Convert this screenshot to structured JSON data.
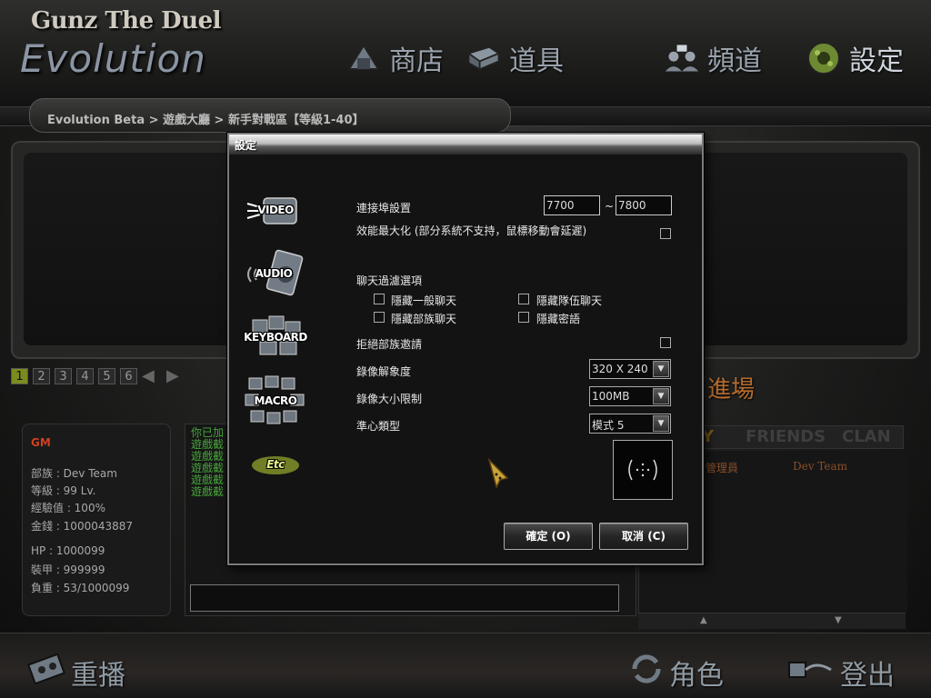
{
  "header": {
    "logo_small": "Gunz The Duel",
    "logo_big": "Evolution",
    "nav": [
      {
        "label": "商店",
        "icon": "shop-icon"
      },
      {
        "label": "道具",
        "icon": "equipment-icon"
      },
      {
        "label": "頻道",
        "icon": "channel-icon"
      },
      {
        "label": "設定",
        "icon": "settings-icon"
      }
    ],
    "breadcrumb": "Evolution Beta > 遊戲大廳 > 新手對戰區【等級1-40】"
  },
  "lobby": {
    "pages": [
      "1",
      "2",
      "3",
      "4",
      "5",
      "6"
    ],
    "enter_label": "進場",
    "player": {
      "name": "GM",
      "clan": "部族 : Dev Team",
      "level": "等級 : 99 Lv.",
      "exp": "經驗值 : 100%",
      "money": "金錢 : 1000043887",
      "hp": "HP : 1000099",
      "ap": "裝甲 : 999999",
      "weight": "負重 : 53/1000099"
    },
    "chat_lines": [
      "你已加",
      "遊戲截",
      "遊戲截",
      "遊戲截",
      "遊戲截",
      "遊戲截"
    ],
    "tabs": [
      "Y",
      "FRIENDS",
      "CLAN"
    ],
    "member": {
      "grade": "管理員",
      "clan": "Dev Team"
    }
  },
  "footer": {
    "replay": "重播",
    "character": "角色",
    "logout": "登出"
  },
  "dialog": {
    "title": "設定",
    "categories": [
      "VIDEO",
      "AUDIO",
      "KEYBOARD",
      "MACRO",
      "Etc"
    ],
    "port_label": "連接埠設置",
    "port_from": "7700",
    "port_sep": "~",
    "port_to": "7800",
    "maximize_perf_label": "效能最大化 (部分系統不支持，鼠標移動會延遲)",
    "chat_filter_label": "聊天過濾選項",
    "hide_general_chat": "隱藏一般聊天",
    "hide_party_chat": "隱藏隊伍聊天",
    "hide_clan_chat": "隱藏部族聊天",
    "hide_whisper": "隱藏密語",
    "reject_clan_invite": "拒絕部族邀請",
    "video_resolution_label": "錄像解象度",
    "video_resolution_value": "320 X 240",
    "video_size_label": "錄像大小限制",
    "video_size_value": "100MB",
    "crosshair_label": "準心類型",
    "crosshair_value": "模式 5",
    "ok_label": "確定 (O)",
    "cancel_label": "取消 (C)"
  }
}
